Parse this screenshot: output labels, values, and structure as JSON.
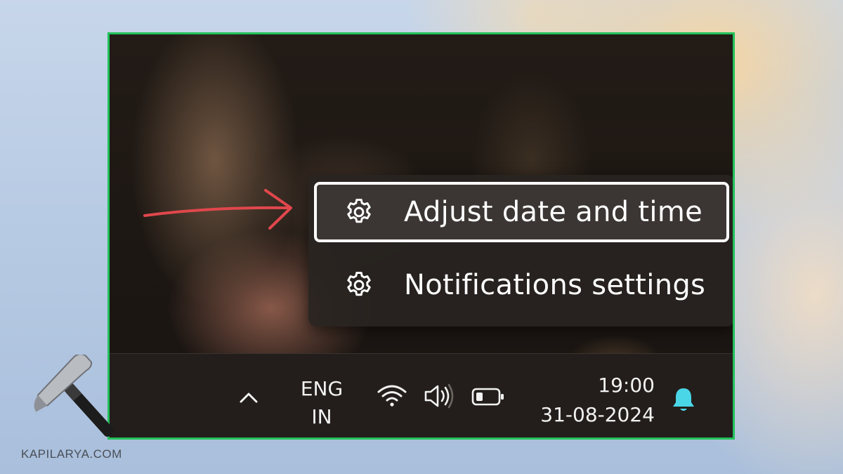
{
  "context_menu": {
    "items": [
      {
        "label": "Adjust date and time",
        "icon": "gear-icon",
        "highlighted": true
      },
      {
        "label": "Notifications settings",
        "icon": "gear-icon",
        "highlighted": false
      }
    ]
  },
  "taskbar": {
    "overflow_icon": "chevron-up-icon",
    "language_line1": "ENG",
    "language_line2": "IN",
    "wifi_icon": "wifi-icon",
    "volume_icon": "volume-icon",
    "battery_icon": "battery-icon",
    "time": "19:00",
    "date": "31-08-2024",
    "notification_icon": "bell-icon"
  },
  "annotation": {
    "arrow_color": "#e0474c",
    "frame_color": "#22c15a"
  },
  "watermark": {
    "text": "KAPILARYA.COM",
    "logo": "hammer-logo"
  }
}
